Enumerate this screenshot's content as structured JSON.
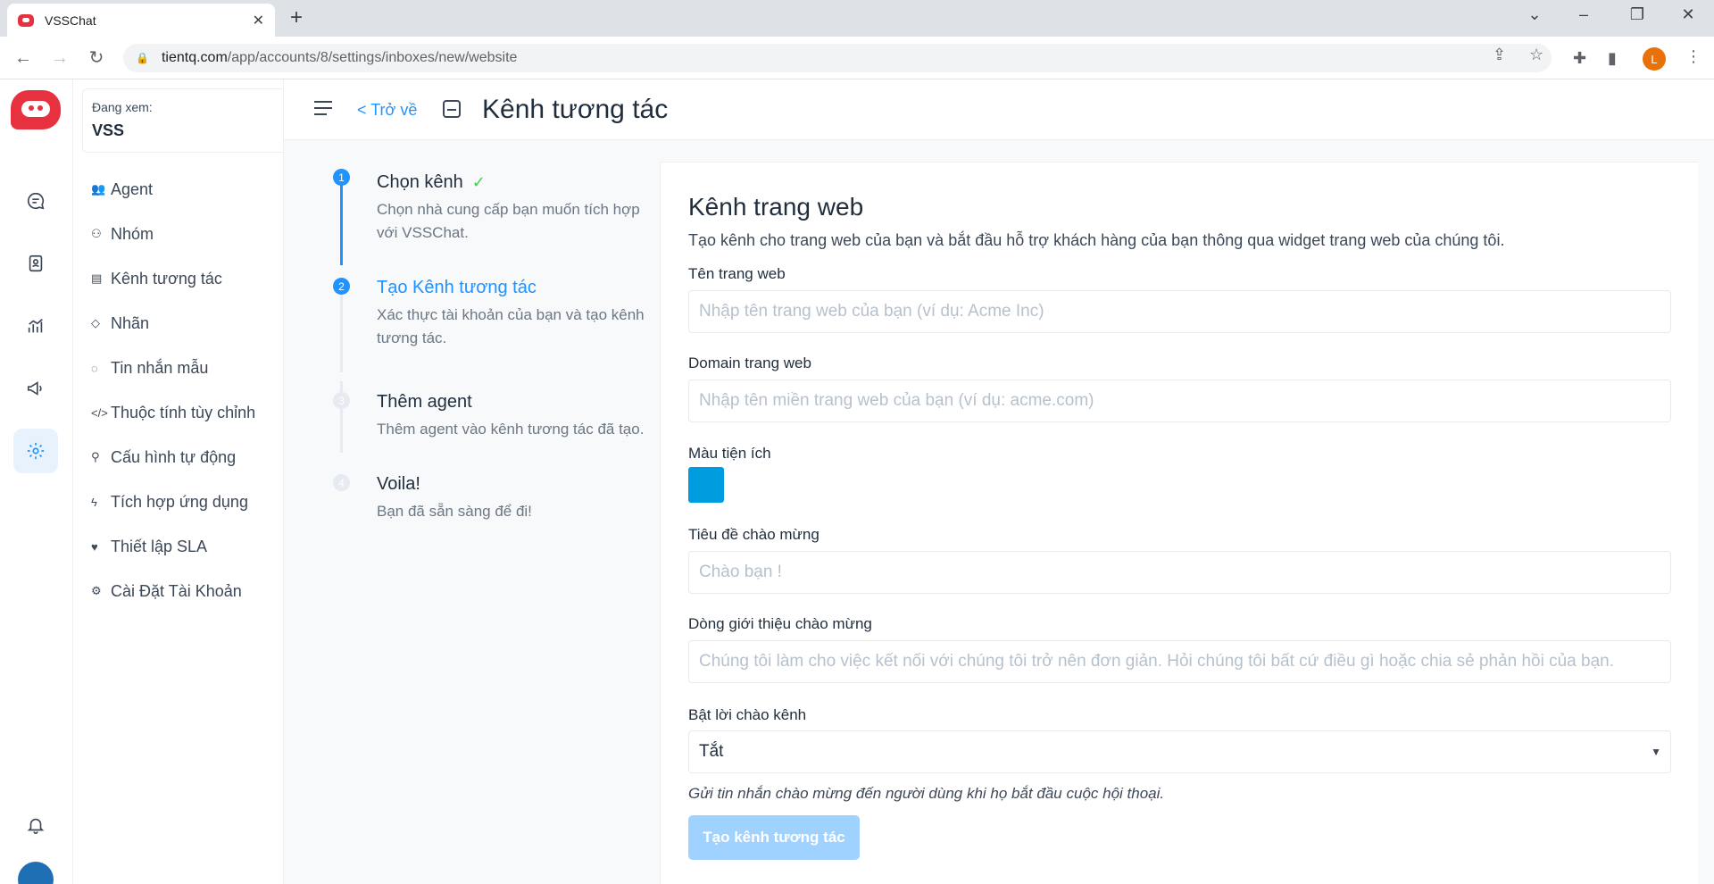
{
  "browser": {
    "tab_title": "VSSChat",
    "tab_close": "✕",
    "new_tab": "+",
    "url_host": "tientq.com",
    "url_path": "/app/accounts/8/settings/inboxes/new/website",
    "profile_initial": "L"
  },
  "account": {
    "viewing_label": "Đang xem:",
    "name": "VSS"
  },
  "sidebar": {
    "items": [
      {
        "label": "Agent",
        "icon": "agents-icon"
      },
      {
        "label": "Nhóm",
        "icon": "teams-icon"
      },
      {
        "label": "Kênh tương tác",
        "icon": "inbox-icon"
      },
      {
        "label": "Nhãn",
        "icon": "tag-icon"
      },
      {
        "label": "Tin nhắn mẫu",
        "icon": "canned-response-icon"
      },
      {
        "label": "Thuộc tính tùy chỉnh",
        "icon": "code-icon"
      },
      {
        "label": "Cấu hình tự động",
        "icon": "automation-icon"
      },
      {
        "label": "Tích hợp ứng dụng",
        "icon": "lightning-icon"
      },
      {
        "label": "Thiết lập SLA",
        "icon": "sla-icon"
      },
      {
        "label": "Cài Đặt Tài Khoản",
        "icon": "settings-icon"
      }
    ]
  },
  "header": {
    "back_label": "Trở về",
    "title": "Kênh tương tác"
  },
  "steps": [
    {
      "number": "1",
      "title": "Chọn kênh",
      "desc": "Chọn nhà cung cấp bạn muốn tích hợp với VSSChat.",
      "state": "done"
    },
    {
      "number": "2",
      "title": "Tạo Kênh tương tác",
      "desc": "Xác thực tài khoản của bạn và tạo kênh tương tác.",
      "state": "active"
    },
    {
      "number": "3",
      "title": "Thêm agent",
      "desc": "Thêm agent vào kênh tương tác đã tạo.",
      "state": "pending"
    },
    {
      "number": "4",
      "title": "Voila!",
      "desc": "Bạn đã sẵn sàng để đi!",
      "state": "pending"
    }
  ],
  "form": {
    "title": "Kênh trang web",
    "description": "Tạo kênh cho trang web của bạn và bắt đầu hỗ trợ khách hàng của bạn thông qua widget trang web của chúng tôi.",
    "website_name_label": "Tên trang web",
    "website_name_placeholder": "Nhập tên trang web của bạn (ví dụ: Acme Inc)",
    "domain_label": "Domain trang web",
    "domain_placeholder": "Nhập tên miền trang web của bạn (ví dụ: acme.com)",
    "color_label": "Màu tiện ích",
    "widget_color": "#009CE0",
    "welcome_title_label": "Tiêu đề chào mừng",
    "welcome_title_placeholder": "Chào bạn !",
    "welcome_tagline_label": "Dòng giới thiệu chào mừng",
    "welcome_tagline_placeholder": "Chúng tôi làm cho việc kết nối với chúng tôi trở nên đơn giản. Hỏi chúng tôi bất cứ điều gì hoặc chia sẻ phản hồi của bạn.",
    "greeting_toggle_label": "Bật lời chào kênh",
    "greeting_toggle_value": "Tắt",
    "greeting_help": "Gửi tin nhắn chào mừng đến người dùng khi họ bắt đầu cuộc hội thoại.",
    "submit_label": "Tạo kênh tương tác"
  },
  "colors": {
    "accent": "#1F93FF",
    "brand": "#E8313F",
    "success": "#44CE4B"
  }
}
